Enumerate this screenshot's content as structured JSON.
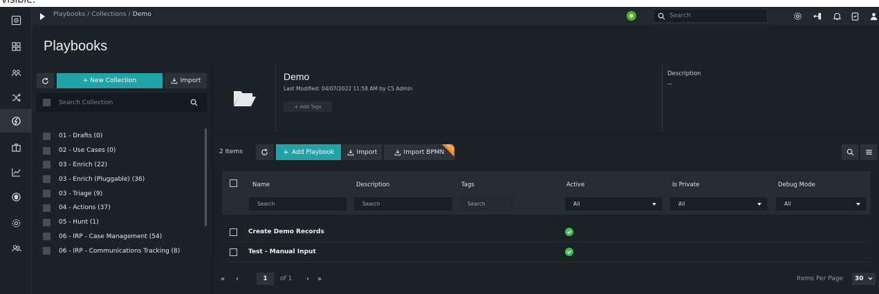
{
  "top_strip_text": "visible.",
  "topbar": {
    "breadcrumb_path": "Playbooks / Collections / ",
    "breadcrumb_current": "Demo",
    "search_placeholder": "Search"
  },
  "page_title": "Playbooks",
  "collections": {
    "new_button": "+ New Collection",
    "import_button": "Import",
    "search_placeholder": "Search Collection",
    "items": [
      "01 - Drafts (0)",
      "02 - Use Cases (0)",
      "03 - Enrich (22)",
      "03 - Enrich (Pluggable) (36)",
      "03 - Triage (9)",
      "04 - Actions (37)",
      "05 - Hunt (1)",
      "06 - IRP - Case Management (54)",
      "06 - IRP - Communications Tracking (8)"
    ]
  },
  "detail": {
    "title": "Demo",
    "last_modified": "Last Modified: 04/07/2022 11:58 AM by CS Admin",
    "add_tags": "+ Add Tags",
    "description_label": "Description",
    "description_value": "--"
  },
  "grid": {
    "items_count": "2 Items",
    "add_playbook": "Add Playbook",
    "import": "Import",
    "import_bpmn": "Import BPMN",
    "beta_label": "BETA",
    "columns": [
      "Name",
      "Description",
      "Tags",
      "Active",
      "Is Private",
      "Debug Mode"
    ],
    "filters": {
      "name_placeholder": "Search",
      "description_placeholder": "Search",
      "tags_placeholder": "Search",
      "active_value": "All",
      "private_value": "All",
      "debug_value": "All"
    },
    "rows": [
      {
        "name": "Create Demo Records",
        "active": true
      },
      {
        "name": "Test - Manual Input",
        "active": true
      }
    ]
  },
  "pager": {
    "first": "«",
    "prev": "‹",
    "current_page": "1",
    "of_text": "of 1",
    "next": "›",
    "last": "»",
    "items_per_page_label": "Items Per Page",
    "items_per_page_value": "30"
  },
  "colors": {
    "accent_teal": "#1fa5a7",
    "status_green": "#3fbf4f",
    "beta_orange": "#f28b1d",
    "background": "#1a1f24"
  },
  "icons": {
    "rail": [
      "dashboard-icon",
      "grid-icon",
      "people-icon",
      "shuffle-icon",
      "playbook-icon",
      "briefcase-icon",
      "chart-icon",
      "shield-icon",
      "gear-icon",
      "users-icon"
    ],
    "topbar": [
      "play-icon",
      "status-dot-icon",
      "search-icon",
      "settings-icon",
      "connector-icon",
      "bell-icon",
      "clipboard-icon",
      "user-icon"
    ]
  }
}
